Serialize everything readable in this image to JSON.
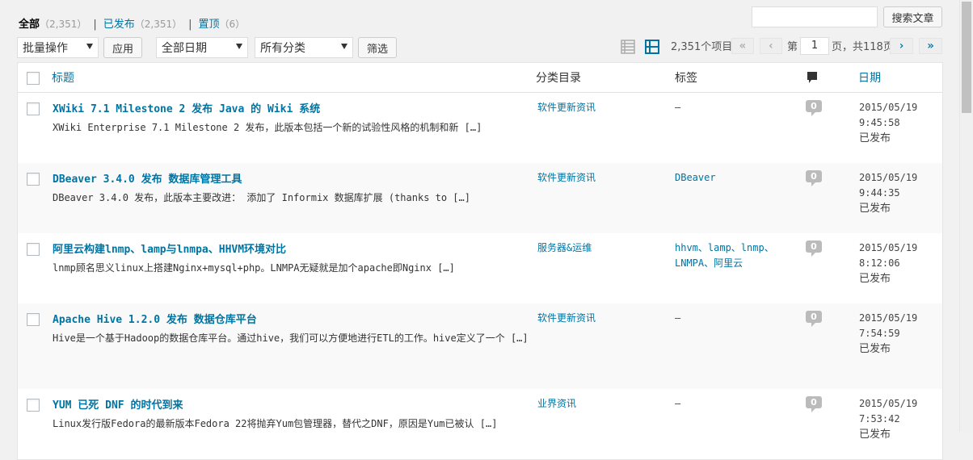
{
  "filters": [
    {
      "label": "全部",
      "count": "（2,351）",
      "current": true
    },
    {
      "label": "已发布",
      "count": "（2,351）",
      "current": false
    },
    {
      "label": "置顶",
      "count": "（6）",
      "current": false
    }
  ],
  "filter_separator": "|",
  "search": {
    "value": "",
    "button": "搜索文章"
  },
  "bulk": {
    "selected": "批量操作",
    "apply": "应用"
  },
  "date_filter": {
    "selected": "全部日期"
  },
  "category_filter": {
    "selected": "所有分类"
  },
  "filter_button": "筛选",
  "pagination": {
    "items": "2,351个项目",
    "first": "«",
    "prev": "‹",
    "page_prefix": "第",
    "current_page": "1",
    "page_suffix": "页，共118页",
    "next": "›",
    "last": "»"
  },
  "columns": {
    "title": "标题",
    "category": "分类目录",
    "tags": "标签",
    "date": "日期"
  },
  "posts": [
    {
      "title": "XWiki 7.1 Milestone 2 发布 Java 的 Wiki 系统",
      "excerpt": "XWiki Enterprise 7.1 Milestone 2 发布，此版本包括一个新的试验性风格的机制和新 […]",
      "category": "软件更新资讯",
      "tags": "—",
      "comments": "0",
      "date": "2015/05/19",
      "time": "9:45:58",
      "status": "已发布"
    },
    {
      "title": "DBeaver 3.4.0 发布 数据库管理工具",
      "excerpt": "DBeaver 3.4.0 发布，此版本主要改进： 添加了 Informix 数据库扩展 (thanks to […]",
      "category": "软件更新资讯",
      "tags": "DBeaver",
      "comments": "0",
      "date": "2015/05/19",
      "time": "9:44:35",
      "status": "已发布"
    },
    {
      "title": "阿里云构建lnmp、lamp与lnmpa、HHVM环境对比",
      "excerpt": "lnmp顾名思义linux上搭建Nginx+mysql+php。LNMPA无疑就是加个apache即Nginx […]",
      "category": "服务器&运维",
      "tags": "hhvm、lamp、lnmp、LNMPA、阿里云",
      "comments": "0",
      "date": "2015/05/19",
      "time": "8:12:06",
      "status": "已发布"
    },
    {
      "title": "Apache Hive 1.2.0 发布 数据仓库平台",
      "excerpt": "Hive是一个基于Hadoop的数据仓库平台。通过hive，我们可以方便地进行ETL的工作。hive定义了一个 […]",
      "category": "软件更新资讯",
      "tags": "—",
      "comments": "0",
      "date": "2015/05/19",
      "time": "7:54:59",
      "status": "已发布"
    },
    {
      "title": "YUM 已死 DNF 的时代到来",
      "excerpt": "Linux发行版Fedora的最新版本Fedora 22将抛弃Yum包管理器，替代之DNF，原因是Yum已被认 […]",
      "category": "业界资讯",
      "tags": "—",
      "comments": "0",
      "date": "2015/05/19",
      "time": "7:53:42",
      "status": "已发布"
    }
  ]
}
